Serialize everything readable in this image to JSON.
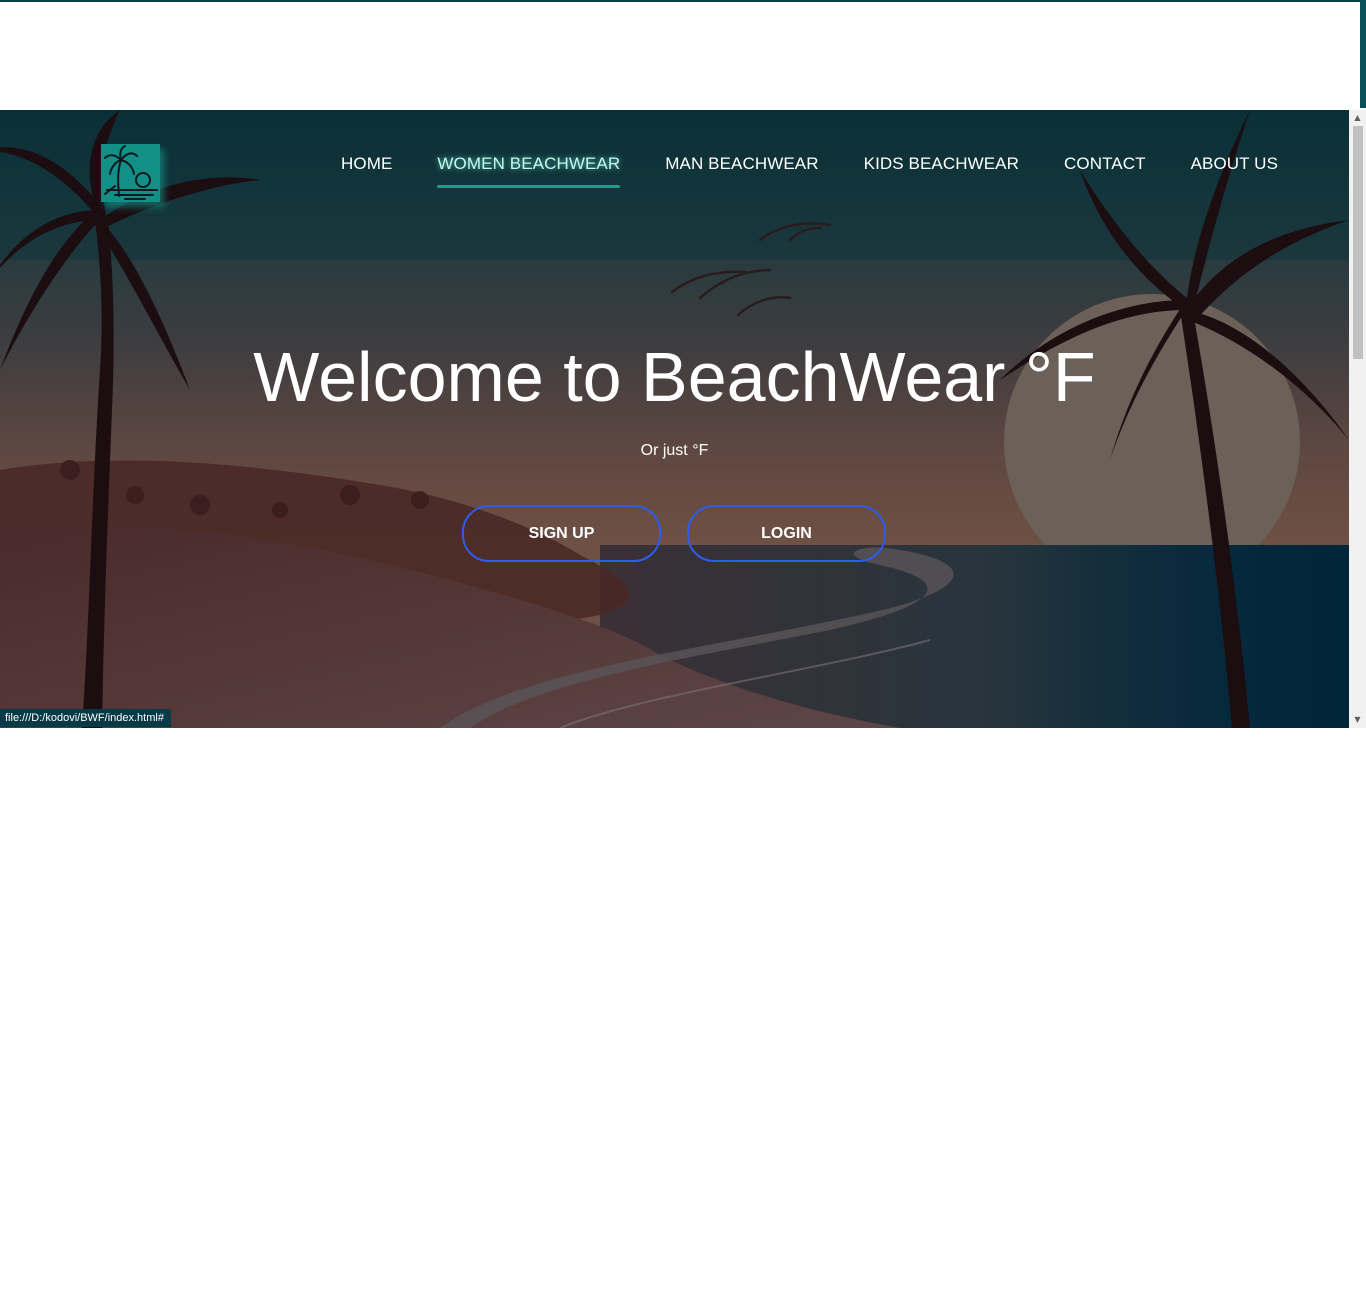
{
  "logo": {
    "icon": "palm-beach-logo-icon",
    "background": "#128f87"
  },
  "nav": {
    "items": [
      {
        "label": "HOME",
        "active": false
      },
      {
        "label": "WOMEN BEACHWEAR",
        "active": true
      },
      {
        "label": "MAN BEACHWEAR",
        "active": false
      },
      {
        "label": "KIDS BEACHWEAR",
        "active": false
      },
      {
        "label": "CONTACT",
        "active": false
      },
      {
        "label": "ABOUT US",
        "active": false
      }
    ],
    "active_underline_color": "#12a18f"
  },
  "hero": {
    "title": "Welcome to BeachWear °F",
    "subtitle": "Or just °F",
    "signup_label": "SIGN UP",
    "login_label": "LOGIN",
    "button_border_color": "#2d5cf0"
  },
  "status_bar": {
    "url": "file:///D:/kodovi/BWF/index.html#"
  },
  "scrollbar": {
    "up_icon": "scroll-up-arrow-icon",
    "down_icon": "scroll-down-arrow-icon"
  }
}
